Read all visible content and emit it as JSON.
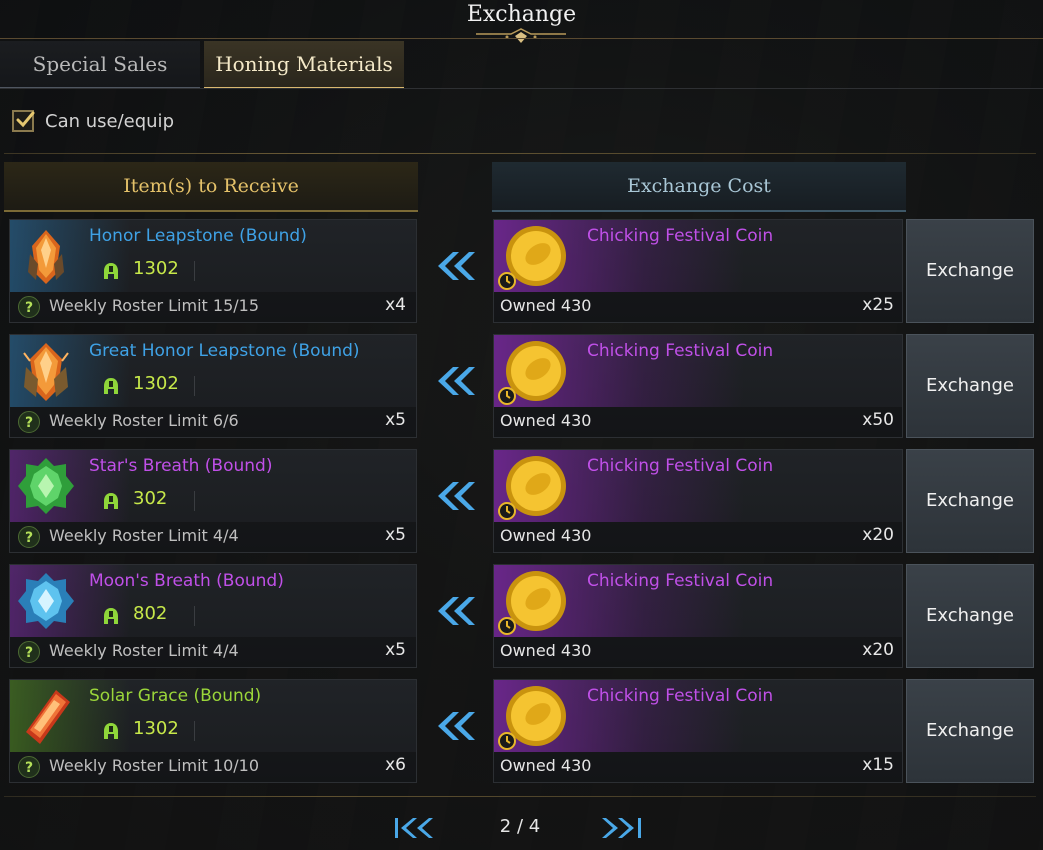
{
  "window": {
    "title": "Exchange"
  },
  "tabs": [
    {
      "label": "Special Sales",
      "active": false
    },
    {
      "label": "Honing Materials",
      "active": true
    }
  ],
  "filter": {
    "label": "Can use/equip",
    "checked": true
  },
  "headers": {
    "receive": "Item(s) to Receive",
    "cost": "Exchange Cost"
  },
  "rows": [
    {
      "name": "Honor Leapstone (Bound)",
      "grade_color": "#3fa2e6",
      "icon": "honor-leapstone-icon",
      "level": "1302",
      "limit": "Weekly Roster Limit 15/15",
      "qty": "x4",
      "cost_name": "Chicking Festival Coin",
      "owned": "Owned 430",
      "cost_qty": "x25",
      "button": "Exchange"
    },
    {
      "name": "Great Honor Leapstone (Bound)",
      "grade_color": "#3fa2e6",
      "icon": "great-honor-leapstone-icon",
      "level": "1302",
      "limit": "Weekly Roster Limit 6/6",
      "qty": "x5",
      "cost_name": "Chicking Festival Coin",
      "owned": "Owned 430",
      "cost_qty": "x50",
      "button": "Exchange"
    },
    {
      "name": "Star's Breath (Bound)",
      "grade_color": "#c050e8",
      "icon": "stars-breath-icon",
      "level": "302",
      "limit": "Weekly Roster Limit 4/4",
      "qty": "x5",
      "cost_name": "Chicking Festival Coin",
      "owned": "Owned 430",
      "cost_qty": "x20",
      "button": "Exchange"
    },
    {
      "name": "Moon's Breath (Bound)",
      "grade_color": "#c050e8",
      "icon": "moons-breath-icon",
      "level": "802",
      "limit": "Weekly Roster Limit 4/4",
      "qty": "x5",
      "cost_name": "Chicking Festival Coin",
      "owned": "Owned 430",
      "cost_qty": "x20",
      "button": "Exchange"
    },
    {
      "name": "Solar Grace (Bound)",
      "grade_color": "#9bd63a",
      "icon": "solar-grace-icon",
      "level": "1302",
      "limit": "Weekly Roster Limit 10/10",
      "qty": "x6",
      "cost_name": "Chicking Festival Coin",
      "owned": "Owned 430",
      "cost_qty": "x15",
      "button": "Exchange"
    }
  ],
  "pagination": {
    "text": "2 / 4"
  },
  "colors": {
    "accent_gold": "#d9b870",
    "epic_purple": "#c050e8",
    "rare_blue": "#3fa2e6",
    "uncommon_green": "#9bd63a"
  }
}
